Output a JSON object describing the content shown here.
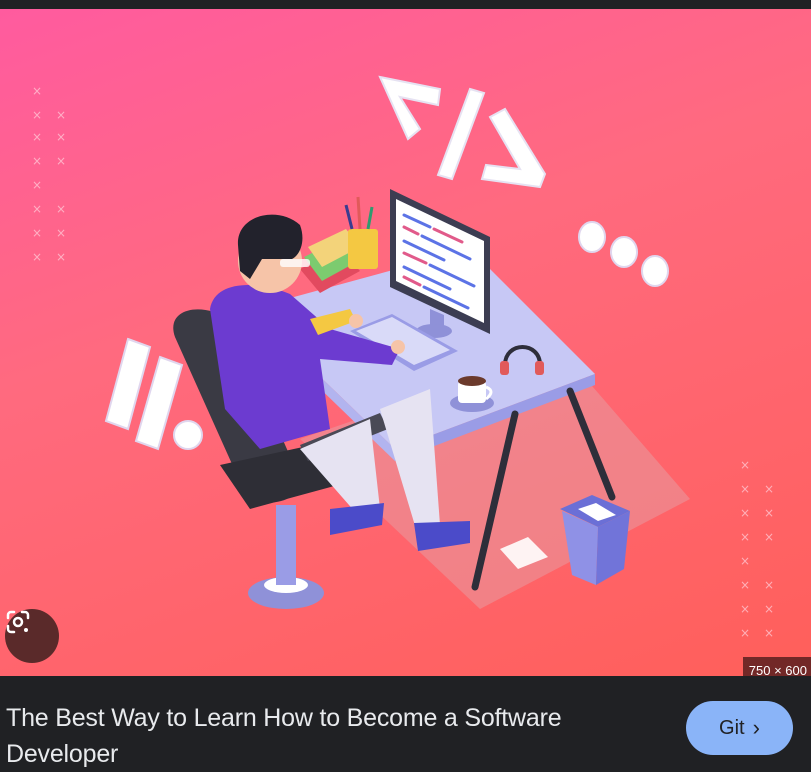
{
  "image_result": {
    "dimensions": "750 × 600",
    "title": "The Best Way to Learn How to Become a Software Developer",
    "visit_label": "Git",
    "visit_icon": "chevron-right-icon",
    "lens_icon": "google-lens-icon"
  },
  "illustration": {
    "code_symbol": "</>"
  },
  "colors": {
    "page_bg": "#202124",
    "button_bg": "#8ab4f8",
    "caption_text": "#e8eaed",
    "illustration_bg_top": "#ff5b9f",
    "illustration_bg_bottom": "#ff5f5a"
  }
}
